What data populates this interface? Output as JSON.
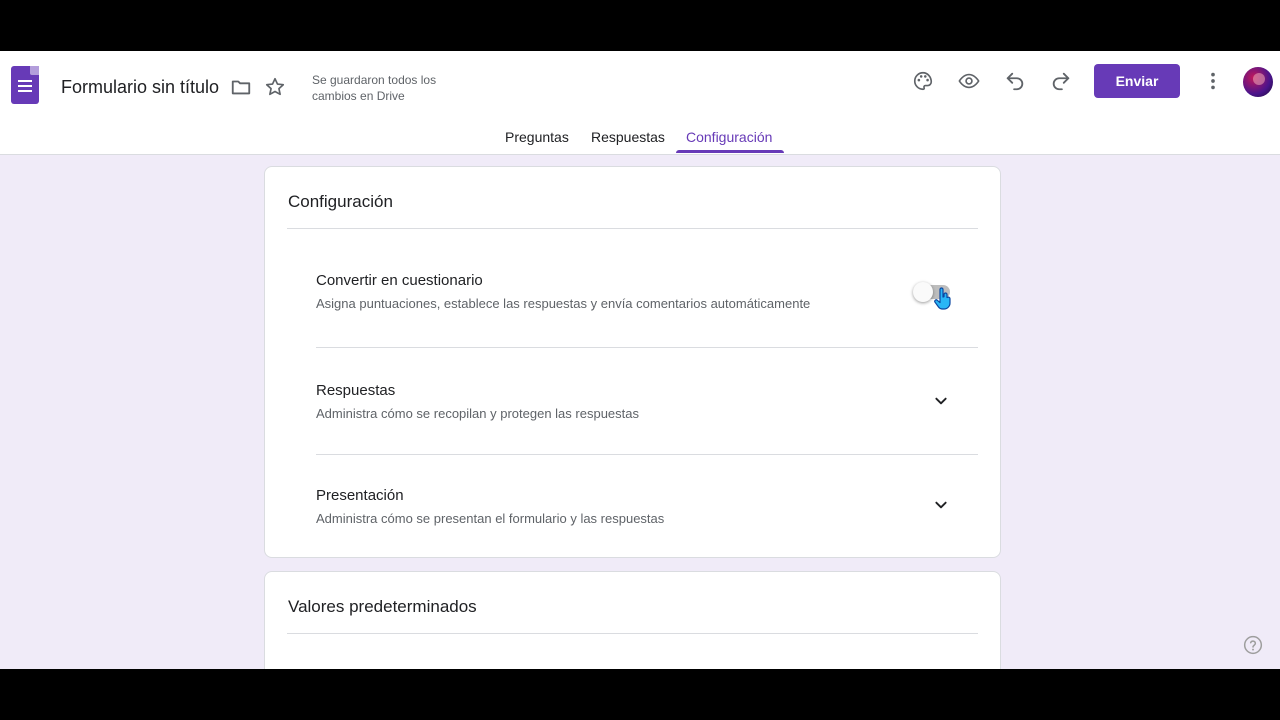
{
  "header": {
    "title": "Formulario sin título",
    "save_status_line1": "Se guardaron todos los",
    "save_status_line2": "cambios en Drive",
    "send_label": "Enviar",
    "icons": [
      "forms-app-icon",
      "folder-icon",
      "star-icon",
      "palette-icon",
      "eye-icon",
      "undo-icon",
      "redo-icon",
      "more-vert-icon",
      "avatar"
    ]
  },
  "tabs": [
    {
      "label": "Preguntas",
      "active": false
    },
    {
      "label": "Respuestas",
      "active": false
    },
    {
      "label": "Configuración",
      "active": true
    }
  ],
  "settings": {
    "title": "Configuración",
    "quiz": {
      "title": "Convertir en cuestionario",
      "description": "Asigna puntuaciones, establece las respuestas y envía comentarios automáticamente",
      "enabled": false
    },
    "responses": {
      "title": "Respuestas",
      "description": "Administra cómo se recopilan y protegen las respuestas"
    },
    "presentation": {
      "title": "Presentación",
      "description": "Administra cómo se presentan el formulario y las respuestas"
    }
  },
  "defaults": {
    "title": "Valores predeterminados"
  },
  "colors": {
    "accent": "#673ab7",
    "background": "#f0ebf8"
  }
}
